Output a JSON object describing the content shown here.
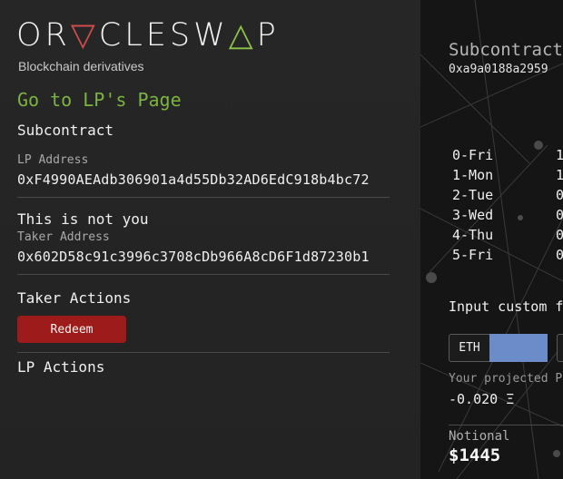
{
  "brand": {
    "logo_before": "OR",
    "logo_tri1": "▽",
    "logo_mid": "CLESW",
    "logo_tri2": "△",
    "logo_after": "P",
    "tagline": "Blockchain derivatives",
    "colors": {
      "red_triangle": "#d34c4c",
      "green_triangle": "#8ac34a",
      "link_green": "#7cb342"
    }
  },
  "nav": {
    "go_to_lp": "Go to LP's Page"
  },
  "subcontract": {
    "heading": "Subcontract",
    "lp_label": "LP Address",
    "lp_address": "0xF4990AEAdb306901a4d55Db32AD6EdC918b4bc72",
    "taker_note": "This is not you",
    "taker_label": "Taker Address",
    "taker_address": "0x602D58c91c3996c3708cDb966A8cD6F1d87230b1"
  },
  "taker_actions": {
    "heading": "Taker Actions",
    "redeem_label": "Redeem",
    "redeem_color": "#9e1b1b"
  },
  "lp_actions": {
    "heading": "LP Actions"
  },
  "right_panel": {
    "title": "Subcontract",
    "hash": "0xa9a0188a2959",
    "schedule": [
      {
        "day": "0-Fri",
        "value": "1"
      },
      {
        "day": "1-Mon",
        "value": "1"
      },
      {
        "day": "2-Tue",
        "value": "0"
      },
      {
        "day": "3-Wed",
        "value": "0"
      },
      {
        "day": "4-Thu",
        "value": "0"
      },
      {
        "day": "5-Fri",
        "value": "0"
      }
    ],
    "input_label": "Input custom f",
    "currency": "ETH",
    "input_value": "",
    "input_color": "#6b8cc8",
    "projected_label": "Your projected P",
    "projected_value": "-0.020 Ξ",
    "notional_label": "Notional",
    "notional_value": "$1445"
  }
}
